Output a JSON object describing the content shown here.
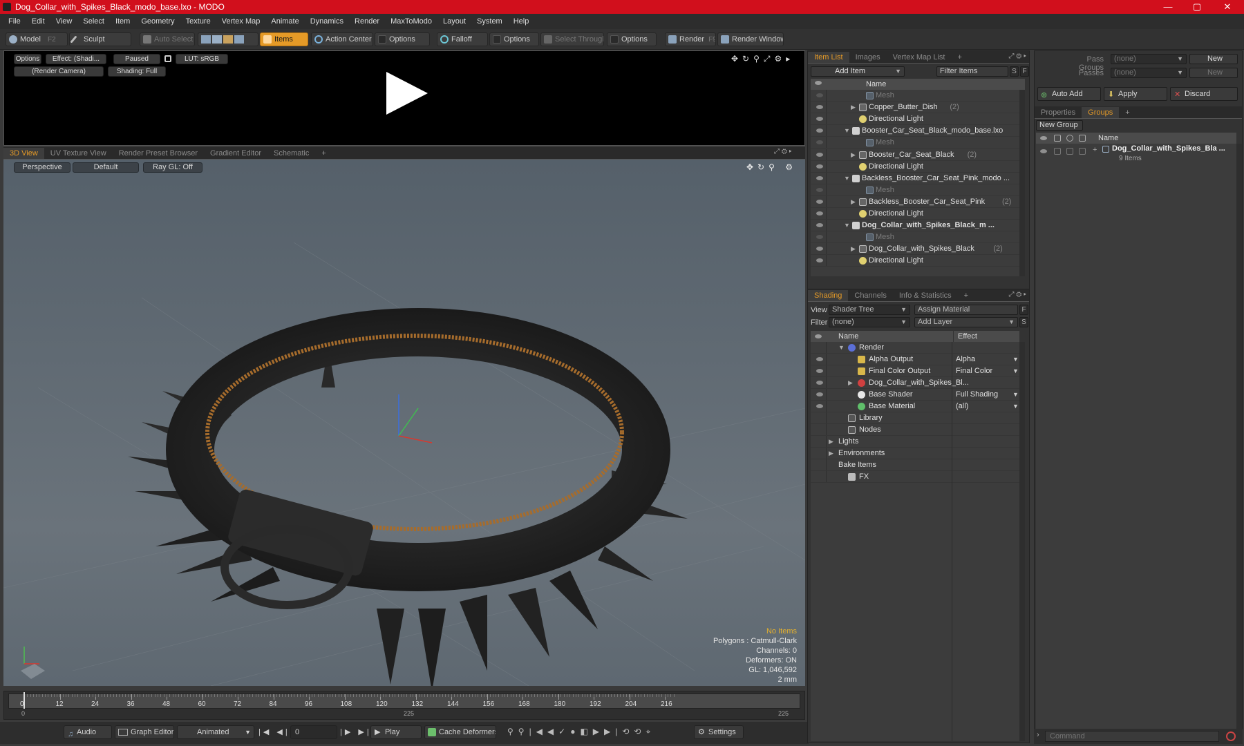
{
  "window": {
    "title": "Dog_Collar_with_Spikes_Black_modo_base.lxo - MODO",
    "min": "—",
    "max": "▢",
    "close": "✕"
  },
  "menu": [
    "File",
    "Edit",
    "View",
    "Select",
    "Item",
    "Geometry",
    "Texture",
    "Vertex Map",
    "Animate",
    "Dynamics",
    "Render",
    "MaxToModo",
    "Layout",
    "System",
    "Help"
  ],
  "toolbar": {
    "model": "Model",
    "model_key": "F2",
    "sculpt": "Sculpt",
    "auto_select": "Auto Select",
    "items": "Items",
    "action_center": "Action Center",
    "options1": "Options",
    "falloff": "Falloff",
    "options2": "Options",
    "select_through": "Select Through",
    "options3": "Options",
    "render": "Render",
    "render_key": "F9",
    "render_window": "Render Window"
  },
  "render_preview": {
    "options": "Options",
    "effect": "Effect: (Shadi...",
    "paused": "Paused",
    "lut": "LUT: sRGB",
    "camera": "(Render Camera)",
    "shading": "Shading: Full"
  },
  "view_tabs": [
    "3D View",
    "UV Texture View",
    "Render Preset Browser",
    "Gradient Editor",
    "Schematic",
    "+"
  ],
  "viewport": {
    "perspective": "Perspective",
    "default": "Default",
    "raygl": "Ray GL: Off",
    "hud": {
      "no_items": "No Items",
      "polygons": "Polygons : Catmull-Clark",
      "channels": "Channels: 0",
      "deformers": "Deformers: ON",
      "gl": "GL: 1,046,592",
      "scale": "2 mm"
    }
  },
  "timeline": {
    "ticks": [
      "0",
      "12",
      "24",
      "36",
      "48",
      "60",
      "72",
      "84",
      "96",
      "108",
      "120",
      "132",
      "144",
      "156",
      "168",
      "180",
      "192",
      "204",
      "216"
    ],
    "range_start": "0",
    "range_mid": "225",
    "range_end": "225"
  },
  "bottom": {
    "audio": "Audio",
    "graph_editor": "Graph Editor",
    "animated": "Animated",
    "frame": "0",
    "play": "Play",
    "cache": "Cache Deformers",
    "settings": "Settings"
  },
  "item_list": {
    "tabs": [
      "Item List",
      "Images",
      "Vertex Map List",
      "+"
    ],
    "add_item": "Add Item",
    "filter_items": "Filter Items",
    "s": "S",
    "f": "F",
    "col_name": "Name",
    "rows": [
      {
        "label": "Mesh",
        "style": "dim",
        "indent": 3,
        "arrow": "",
        "icon": "mesh"
      },
      {
        "label": "Copper_Butter_Dish",
        "count": "(2)",
        "style": "",
        "indent": 2,
        "arrow": "▶",
        "icon": "group"
      },
      {
        "label": "Directional Light",
        "style": "",
        "indent": 2,
        "arrow": "",
        "icon": "light"
      },
      {
        "label": "Booster_Car_Seat_Black_modo_base.lxo",
        "style": "",
        "indent": 1,
        "arrow": "▼",
        "icon": "scene"
      },
      {
        "label": "Mesh",
        "style": "dim",
        "indent": 3,
        "arrow": "",
        "icon": "mesh"
      },
      {
        "label": "Booster_Car_Seat_Black",
        "count": "(2)",
        "style": "",
        "indent": 2,
        "arrow": "▶",
        "icon": "group"
      },
      {
        "label": "Directional Light",
        "style": "",
        "indent": 2,
        "arrow": "",
        "icon": "light"
      },
      {
        "label": "Backless_Booster_Car_Seat_Pink_modo ...",
        "style": "",
        "indent": 1,
        "arrow": "▼",
        "icon": "scene"
      },
      {
        "label": "Mesh",
        "style": "dim",
        "indent": 3,
        "arrow": "",
        "icon": "mesh"
      },
      {
        "label": "Backless_Booster_Car_Seat_Pink",
        "count": "(2)",
        "style": "",
        "indent": 2,
        "arrow": "▶",
        "icon": "group"
      },
      {
        "label": "Directional Light",
        "style": "",
        "indent": 2,
        "arrow": "",
        "icon": "light"
      },
      {
        "label": "Dog_Collar_with_Spikes_Black_m ...",
        "style": "bold",
        "indent": 1,
        "arrow": "▼",
        "icon": "scene"
      },
      {
        "label": "Mesh",
        "style": "dim",
        "indent": 3,
        "arrow": "",
        "icon": "mesh"
      },
      {
        "label": "Dog_Collar_with_Spikes_Black",
        "count": "(2)",
        "style": "",
        "indent": 2,
        "arrow": "▶",
        "icon": "group"
      },
      {
        "label": "Directional Light",
        "style": "",
        "indent": 2,
        "arrow": "",
        "icon": "light"
      }
    ]
  },
  "shading": {
    "tabs": [
      "Shading",
      "Channels",
      "Info & Statistics",
      "+"
    ],
    "view_label": "View",
    "view_value": "Shader Tree",
    "assign": "Assign Material",
    "filter_label": "Filter",
    "filter_value": "(none)",
    "add_layer": "Add Layer",
    "f": "F",
    "s": "S",
    "col_name": "Name",
    "col_effect": "Effect",
    "rows": [
      {
        "label": "Render",
        "effect": "",
        "indent": 1,
        "arrow": "▼",
        "icon": "render",
        "eye": false
      },
      {
        "label": "Alpha Output",
        "effect": "Alpha",
        "indent": 2,
        "arrow": "",
        "icon": "output",
        "eye": true
      },
      {
        "label": "Final Color Output",
        "effect": "Final Color",
        "indent": 2,
        "arrow": "",
        "icon": "output",
        "eye": true
      },
      {
        "label": "Dog_Collar_with_Spikes_Bl...",
        "effect": "",
        "indent": 2,
        "arrow": "▶",
        "icon": "material",
        "eye": true
      },
      {
        "label": "Base Shader",
        "effect": "Full Shading",
        "indent": 2,
        "arrow": "",
        "icon": "shader",
        "eye": true
      },
      {
        "label": "Base Material",
        "effect": "(all)",
        "indent": 2,
        "arrow": "",
        "icon": "basemat",
        "eye": true
      },
      {
        "label": "Library",
        "effect": "",
        "indent": 1,
        "arrow": "",
        "icon": "folder",
        "eye": false
      },
      {
        "label": "Nodes",
        "effect": "",
        "indent": 1,
        "arrow": "",
        "icon": "folder",
        "eye": false
      },
      {
        "label": "Lights",
        "effect": "",
        "indent": 0,
        "arrow": "▶",
        "icon": "",
        "eye": false
      },
      {
        "label": "Environments",
        "effect": "",
        "indent": 0,
        "arrow": "▶",
        "icon": "",
        "eye": false
      },
      {
        "label": "Bake Items",
        "effect": "",
        "indent": 0,
        "arrow": "",
        "icon": "",
        "eye": false
      },
      {
        "label": "FX",
        "effect": "",
        "indent": 1,
        "arrow": "",
        "icon": "fx",
        "eye": false
      }
    ]
  },
  "groups": {
    "pass_groups_label": "Pass Groups",
    "pass_groups_value": "(none)",
    "new1": "New",
    "passes_label": "Passes",
    "passes_value": "(none)",
    "new2": "New",
    "auto_add": "Auto Add",
    "apply": "Apply",
    "discard": "Discard",
    "tabs": [
      "Properties",
      "Groups",
      "+"
    ],
    "new_group": "New Group",
    "col_name": "Name",
    "item_name": "Dog_Collar_with_Spikes_Bla ...",
    "item_count": "9 Items"
  },
  "command": {
    "placeholder": "Command"
  },
  "colors": {
    "accent": "#e59a27",
    "titlebar": "#d10f1c"
  }
}
